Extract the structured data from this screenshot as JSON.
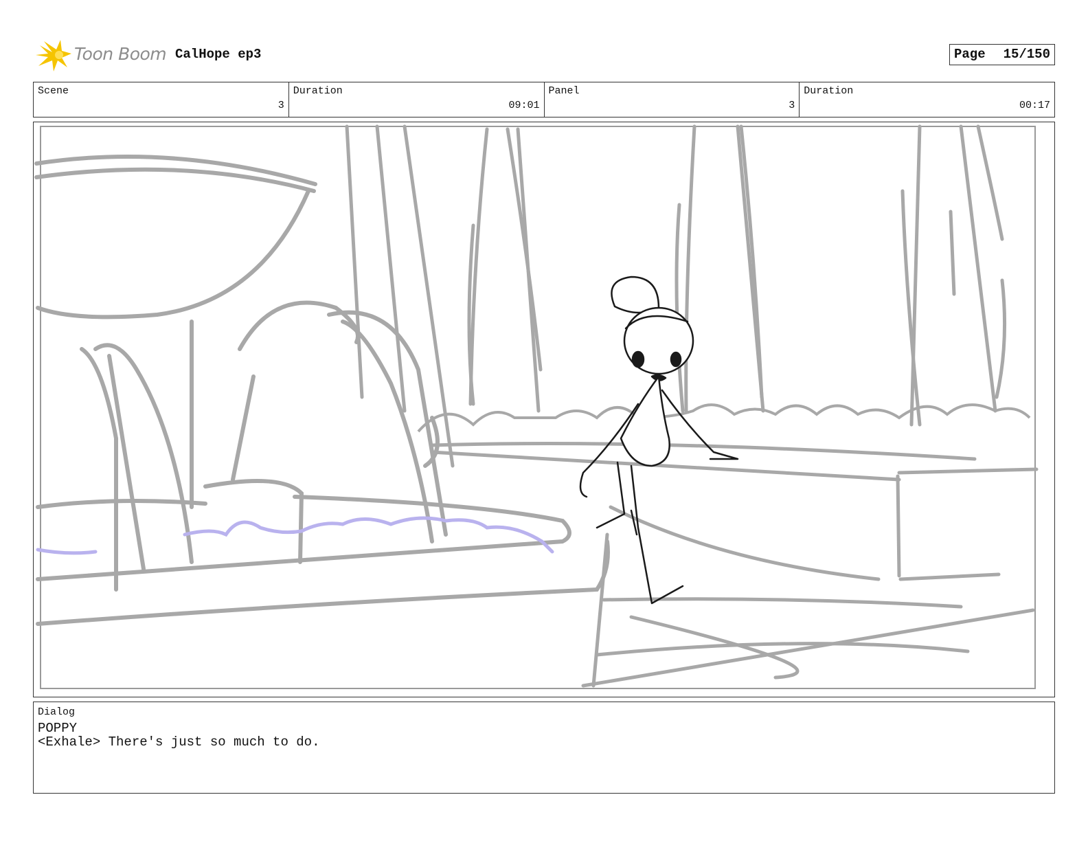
{
  "header": {
    "logo_text": "Toon Boom",
    "project_title": "CalHope ep3",
    "page_label": "Page",
    "page_number": "15/150"
  },
  "info": {
    "scene_label": "Scene",
    "scene_value": "3",
    "scene_duration_label": "Duration",
    "scene_duration_value": "09:01",
    "panel_label": "Panel",
    "panel_value": "3",
    "panel_duration_label": "Duration",
    "panel_duration_value": "00:17"
  },
  "dialog": {
    "label": "Dialog",
    "character": "POPPY",
    "line": "<Exhale> There's just so much to do."
  },
  "colors": {
    "sketch_gray": "#a8a8a8",
    "ink": "#1a1a1a",
    "water": "#b9b2ee",
    "logo_yellow": "#f5c400",
    "logo_gray": "#8c8c8c"
  }
}
